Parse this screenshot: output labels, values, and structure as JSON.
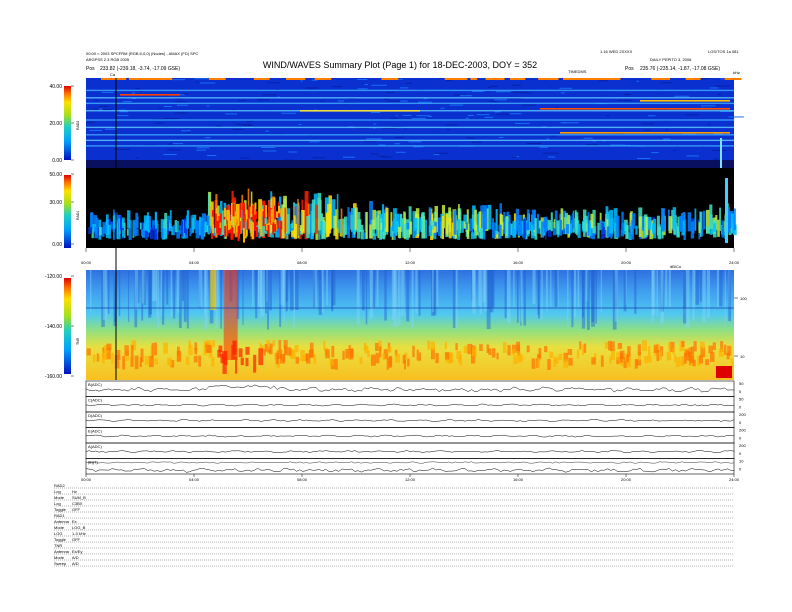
{
  "header": {
    "title": "WIND/WAVES Summary Plot (Page 1) for 18-DEC-2003, DOY = 352",
    "left_line1": "00:00 = 2003 SPCFRM (RGB:0,0,0) (Nodes) - AMAX (FD) SPC",
    "left_line2": "ARGPSS 2.3 RGB 2005",
    "left_pos_prefix": "Pos",
    "left_pos_value": "233.82 (-239.18, -3.74, -17.09 GSE)",
    "right_line1": "1.16 WED 2XXXX",
    "right_line1b": "LOS/TOS 1a 081",
    "right_line2": "DAILY PEPITO 3, 2006",
    "right_pos_prefix": "Pos",
    "right_pos_value": "235.76 (-235.14, -1.87, -17.08 GSE)",
    "top_axis_label": "TIMEDMS",
    "top_right_label": "kHz",
    "cursor_label": "Ca"
  },
  "panel_labels": {
    "rad2": "RAD2",
    "rad1": "RAD1",
    "tnr": "TNR"
  },
  "right_axis_label": "dB/Cu",
  "footer_blocks": [
    {
      "header": "RAD2",
      "rows": [
        {
          "label": "Log",
          "value": "Hz"
        },
        {
          "label": "Mode",
          "value": "SUM_B"
        },
        {
          "label": "Log",
          "value": "C3BX"
        },
        {
          "label": "Toggle",
          "value": "OFF"
        }
      ]
    },
    {
      "header": "RAD1",
      "rows": [
        {
          "label": "Antenna",
          "value": "Ex"
        },
        {
          "label": "Mode",
          "value": "LOG_B"
        },
        {
          "label": "LOG",
          "value": "1-3 kHz"
        },
        {
          "label": "Toggle",
          "value": "OFF"
        }
      ]
    },
    {
      "header": "TNR",
      "rows": [
        {
          "label": "Antenna",
          "value": "Ex/Ey"
        },
        {
          "label": "Mode",
          "value": "A/D"
        },
        {
          "label": "Sweep",
          "value": "A/D"
        }
      ]
    }
  ],
  "chart_data": [
    {
      "type": "heatmap",
      "name": "RAD2",
      "ylim": [
        0,
        40
      ],
      "ytick_labels": [
        "40.00",
        "20.00",
        "0.00"
      ],
      "yticks": [
        40,
        20,
        0
      ],
      "xlim": [
        0,
        24
      ],
      "band_lines_y": [
        38,
        34,
        31,
        27,
        22,
        18,
        14,
        11,
        8
      ]
    },
    {
      "type": "heatmap",
      "name": "RAD1",
      "ylim": [
        0,
        50
      ],
      "ytick_labels": [
        "50.00",
        "30.00",
        "0.00"
      ],
      "yticks": [
        50,
        30,
        0
      ],
      "xlim": [
        0,
        24
      ],
      "xtick_labels": [
        "00:00",
        "04:00",
        "08:00",
        "12:00",
        "16:00",
        "20:00",
        "24:00"
      ],
      "xticks": [
        0,
        4,
        8,
        12,
        16,
        20,
        24
      ]
    },
    {
      "type": "heatmap",
      "name": "TNR",
      "ylim": [
        -160,
        -120
      ],
      "ytick_labels": [
        "-120.00",
        "-140.00",
        "-160.00"
      ],
      "yticks": [
        -120,
        -140,
        -160
      ],
      "xlim": [
        0,
        24
      ],
      "right_tick_labels": [
        "100",
        "10"
      ],
      "right_ticks": [
        100,
        10
      ]
    },
    {
      "type": "line",
      "name": "B (ADC)",
      "rows": [
        {
          "label": "B(ADC)",
          "right_ticks": [
            "50",
            "0"
          ]
        },
        {
          "label": "C(ADC)",
          "right_ticks": [
            "50",
            "0"
          ]
        },
        {
          "label": "D(ADC)",
          "right_ticks": [
            "200",
            "0"
          ]
        },
        {
          "label": "E(ADC)",
          "right_ticks": [
            "200",
            "0"
          ]
        },
        {
          "label": "A(ADC)",
          "right_ticks": [
            "200",
            "0"
          ]
        },
        {
          "label": "|B|(T)",
          "right_ticks": [
            "10",
            "0"
          ]
        }
      ],
      "xlim": [
        0,
        24
      ],
      "xtick_labels": [
        "00:00",
        "04:00",
        "08:00",
        "12:00",
        "16:00",
        "20:00",
        "24:00"
      ],
      "xticks": [
        0,
        4,
        8,
        12,
        16,
        20,
        24
      ]
    }
  ]
}
